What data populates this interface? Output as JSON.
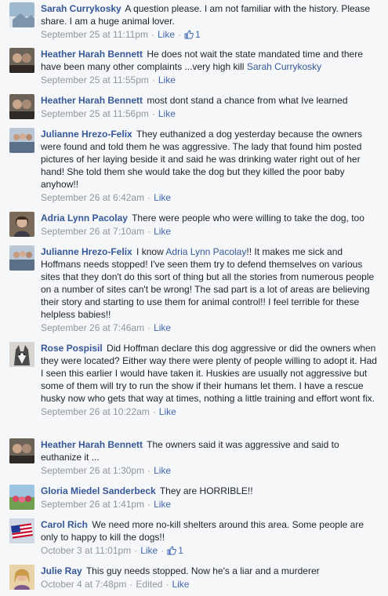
{
  "comments": [
    {
      "author": "Sarah Currykosky",
      "text": "A question please. I am not familiar with the history. Please share. I am a huge animal lover.",
      "mention": "",
      "text_after": "",
      "time": "September 25 at 11:11pm",
      "like": "Like",
      "likes": "1",
      "edited": ""
    },
    {
      "author": "Heather Harah Bennett",
      "text": "He does not wait the state mandated time and there have been many other complaints ...very high kill",
      "mention": "Sarah Currykosky",
      "text_after": "",
      "time": "September 25 at 11:55pm",
      "like": "Like",
      "likes": "",
      "edited": ""
    },
    {
      "author": "Heather Harah Bennett",
      "text": "most dont stand a chance from what Ive learned",
      "mention": "",
      "text_after": "",
      "time": "September 25 at 11:56pm",
      "like": "Like",
      "likes": "",
      "edited": ""
    },
    {
      "author": "Julianne Hrezo-Felix",
      "text": "They euthanized a dog yesterday because the owners were found and told them he was aggressive. The lady that found him posted pictures of her laying beside it and said he was drinking water right out of her hand! She told them she would take the dog but they killed the poor baby anyhow!!",
      "mention": "",
      "text_after": "",
      "time": "September 26 at 6:42am",
      "like": "Like",
      "likes": "",
      "edited": ""
    },
    {
      "author": "Adria Lynn Pacolay",
      "text": "There were people who were willing to take the dog, too",
      "mention": "",
      "text_after": "",
      "time": "September 26 at 7:10am",
      "like": "Like",
      "likes": "",
      "edited": ""
    },
    {
      "author": "Julianne Hrezo-Felix",
      "text": "I know",
      "mention": "Adria Lynn Pacolay",
      "text_after": "!! It makes me sick and Hoffmans needs stopped! I've seen them try to defend themselves on various sites that they don't do this sort of thing but all the stories from numerous people on a number of sites can't be wrong! The sad part is a lot of areas are believing their story and starting to use them for animal control!! I feel terrible for these helpless babies!!",
      "time": "September 26 at 7:46am",
      "like": "Like",
      "likes": "",
      "edited": ""
    },
    {
      "author": "Rose Pospisil",
      "text": "Did Hoffman declare this dog aggressive or did the owners when they were located? Either way there were plenty of people willing to adopt it. Had I seen this earlier I would have taken it. Huskies are usually not aggressive but some of them will try to run the show if their humans let them. I have a rescue husky now who gets that way at times, nothing a little training and effort wont fix.",
      "mention": "",
      "text_after": "",
      "time": "September 26 at 10:22am",
      "like": "Like",
      "likes": "",
      "edited": ""
    },
    {
      "author": "Heather Harah Bennett",
      "text": "The owners said it was aggressive and said to euthanize it ...",
      "mention": "",
      "text_after": "",
      "time": "September 26 at 1:30pm",
      "like": "Like",
      "likes": "",
      "edited": ""
    },
    {
      "author": "Gloria Miedel Sanderbeck",
      "text": "They are HORRIBLE!!",
      "mention": "",
      "text_after": "",
      "time": "September 26 at 1:41pm",
      "like": "Like",
      "likes": "",
      "edited": ""
    },
    {
      "author": "Carol Rich",
      "text": "We need more no-kill shelters around this area. Some people are only to happy to kill the dogs!!",
      "mention": "",
      "text_after": "",
      "time": "October 3 at 11:01pm",
      "like": "Like",
      "likes": "1",
      "edited": ""
    },
    {
      "author": "Julie Ray",
      "text": "This guy needs stopped. Now he's a liar and a murderer",
      "mention": "",
      "text_after": "",
      "time": "October 4 at 7:48pm",
      "like": "Like",
      "likes": "",
      "edited": "Edited"
    }
  ],
  "colors": {
    "name": "#365899",
    "link": "#4267b2",
    "meta": "#90949c",
    "text": "#1d2129",
    "background": "#f6f7f9"
  },
  "icons": {
    "like_count": "thumbs-up-icon"
  }
}
